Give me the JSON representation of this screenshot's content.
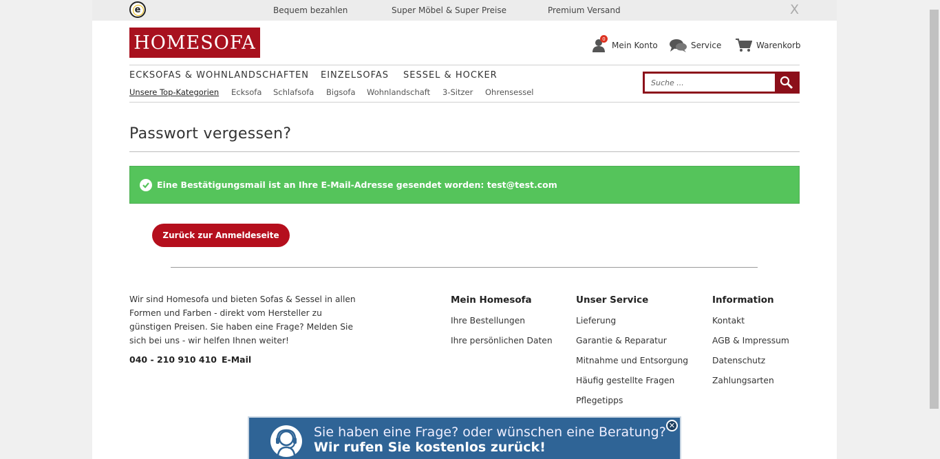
{
  "topbar": {
    "usps": [
      "Bequem bezahlen",
      "Super Möbel & Super Preise",
      "Premium Versand"
    ],
    "trust_badge": "e",
    "close": "X"
  },
  "header": {
    "logo": "HOMESOFA",
    "account_label": "Mein Konto",
    "account_badge": "0",
    "service_label": "Service",
    "cart_label": "Warenkorb"
  },
  "nav": {
    "main": [
      "ECKSOFAS & WOHNLANDSCHAFTEN",
      "EINZELSOFAS",
      "SESSEL & HOCKER"
    ],
    "sub": [
      "Unsere Top-Kategorien",
      "Ecksofa",
      "Schlafsofa",
      "Bigsofa",
      "Wohnlandschaft",
      "3-Sitzer",
      "Ohrensessel"
    ]
  },
  "search": {
    "placeholder": "Suche ..."
  },
  "content": {
    "title": "Passwort vergessen?",
    "alert": "Eine Bestätigungsmail ist an Ihre E-Mail-Adresse gesendet worden: test@test.com",
    "back_button": "Zurück zur Anmeldeseite"
  },
  "footer": {
    "about": "Wir sind Homesofa und bieten Sofas & Sessel in allen Formen und Farben - direkt vom Hersteller zu günstigen Preisen. Sie haben eine Frage? Melden Sie sich bei uns - wir helfen Ihnen weiter!",
    "phone": "040 - 210 910 410",
    "email": "E-Mail",
    "columns": [
      {
        "title": "Mein Homesofa",
        "links": [
          "Ihre Bestellungen",
          "Ihre persönlichen Daten"
        ]
      },
      {
        "title": "Unser Service",
        "links": [
          "Lieferung",
          "Garantie & Reparatur",
          "Mitnahme und Entsorgung",
          "Häufig gestellte Fragen",
          "Pflegetipps"
        ]
      },
      {
        "title": "Information",
        "links": [
          "Kontakt",
          "AGB & Impressum",
          "Datenschutz",
          "Zahlungsarten"
        ]
      }
    ]
  },
  "callback": {
    "line1": "Sie haben eine Frage? oder wünschen eine Beratung?",
    "line2": "Wir rufen Sie kostenlos zurück!"
  },
  "colors": {
    "brand": "#a8111e",
    "button": "#b50f1d",
    "success": "#55c45b",
    "callback_bg": "#2f6496"
  }
}
